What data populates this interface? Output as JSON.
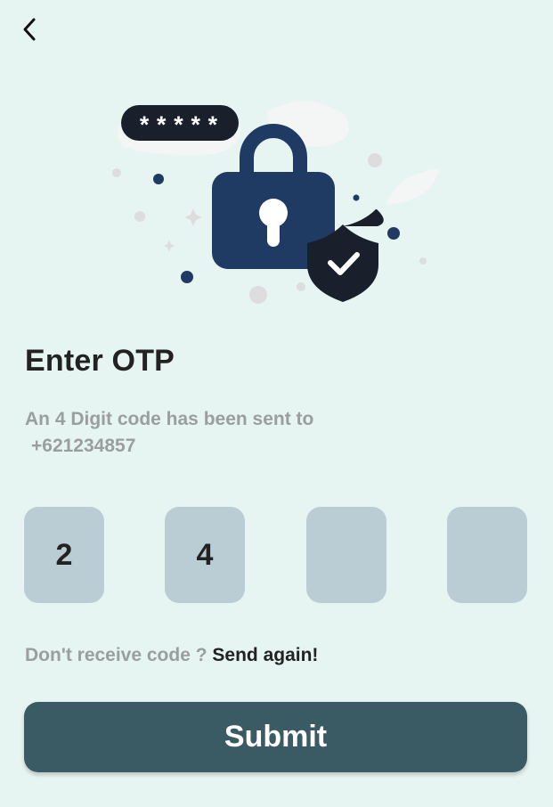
{
  "nav": {
    "back_icon": "chevron-left-icon"
  },
  "hero": {
    "password_mask": "*****",
    "lock_icon": "padlock-icon",
    "badge_icon": "shield-check-icon"
  },
  "page": {
    "title": "Enter OTP",
    "subtitle_line1": "An 4 Digit code has been sent to",
    "phone": "+621234857"
  },
  "otp": {
    "digits": [
      "2",
      "4",
      "",
      ""
    ]
  },
  "resend": {
    "question": "Don't receive code ?",
    "link": "Send again!"
  },
  "submit": {
    "label": "Submit"
  },
  "colors": {
    "background": "#E6F5F2",
    "otp_box": "#BACCD4",
    "primary_button": "#3A5B63",
    "lock": "#1F3B64",
    "shield": "#19202B",
    "muted_text": "#9A9E9E",
    "dark_text": "#222222"
  }
}
